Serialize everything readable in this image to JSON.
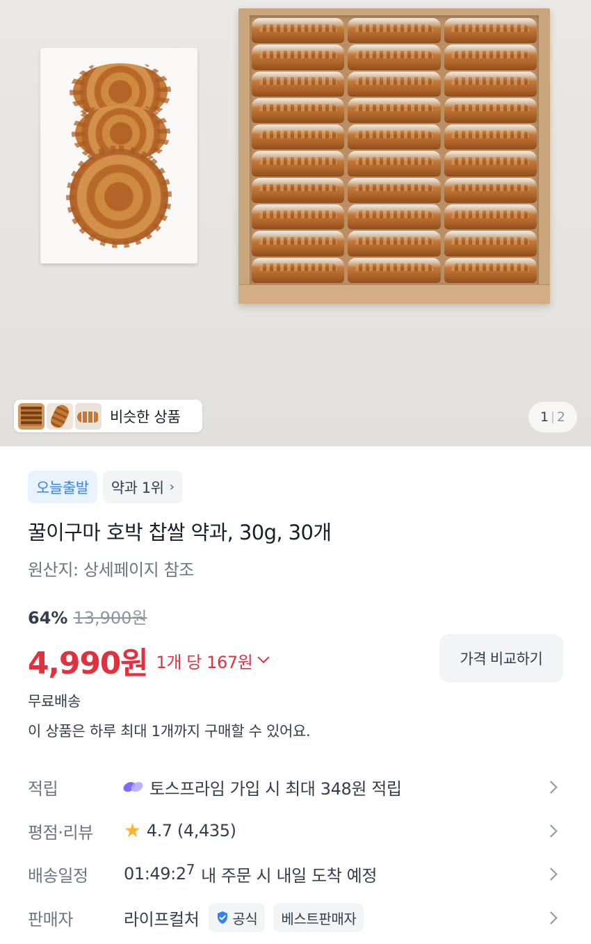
{
  "gallery": {
    "similar_label": "비슷한 상품",
    "counter_current": "1",
    "counter_separator": "|",
    "counter_total": "2"
  },
  "tags": [
    {
      "label": "오늘출발",
      "style": "blue"
    },
    {
      "label": "약과 1위",
      "style": "gray",
      "icon": "chevron-right-icon"
    }
  ],
  "product": {
    "title": "꿀이구마 호박 찹쌀 약과, 30g, 30개",
    "origin": "원산지: 상세페이지 참조"
  },
  "pricing": {
    "discount": "64%",
    "original_price": "13,900원",
    "price": "4,990원",
    "unit_price": "1개 당 167원",
    "compare_label": "가격 비교하기",
    "accent_color": "#e0313f"
  },
  "shipping": {
    "free_shipping": "무료배송",
    "purchase_limit": "이 상품은 하루 최대 1개까지 구매할 수 있어요."
  },
  "rows": {
    "points": {
      "label": "적립",
      "value": "토스프라임 가입 시 최대 348원 적립",
      "icon": "toss-prime-icon"
    },
    "rating": {
      "label": "평점·리뷰",
      "value": "4.7 (4,435)",
      "icon": "star-icon"
    },
    "delivery": {
      "label": "배송일정",
      "countdown": "01:49:2",
      "countdown_last": "7",
      "value": "내 주문 시 내일 도착 예정"
    },
    "seller": {
      "label": "판매자",
      "value": "라이프컬처",
      "badge_official": "공식",
      "badge_best": "베스트판매자",
      "icon": "verified-shield-icon"
    }
  }
}
